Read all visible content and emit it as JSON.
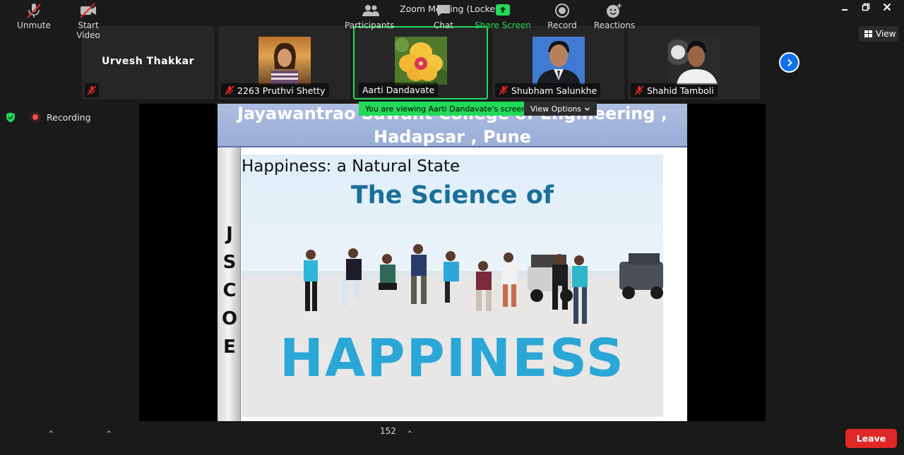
{
  "window": {
    "title": "Zoom Meeting (Locked)"
  },
  "header": {
    "view_label": "View"
  },
  "participants": [
    {
      "name": "Urvesh Thakkar",
      "video": false
    },
    {
      "name": "2263 Pruthvi Shetty",
      "video": true
    },
    {
      "name": "Aarti Dandavate",
      "video": true,
      "active": true
    },
    {
      "name": "Shubham Salunkhe",
      "video": true
    },
    {
      "name": "Shahid Tamboli",
      "video": true
    }
  ],
  "status": {
    "recording_label": "Recording"
  },
  "share": {
    "viewing_text": "You are viewing Aarti Dandavate's screen",
    "view_options_label": "View Options"
  },
  "slide": {
    "header_line1": "Jayawantrao Sawant College of Engineering ,",
    "header_line2": "Hadapsar , Pune",
    "side_letters": [
      "J",
      "S",
      "C",
      "O",
      "E"
    ],
    "picture_title": "Happiness: a Natural State",
    "science_text": "The Science of",
    "happiness_text": "HAPPINESS"
  },
  "toolbar": {
    "unmute_label": "Unmute",
    "start_video_label": "Start Video",
    "participants_label": "Participants",
    "participants_count": "152",
    "chat_label": "Chat",
    "share_label": "Share Screen",
    "record_label": "Record",
    "reactions_label": "Reactions",
    "leave_label": "Leave"
  },
  "colors": {
    "accent_green": "#23d959",
    "leave_red": "#e02828",
    "zoom_blue": "#0e72ed",
    "share_icon_green": "#23d959"
  }
}
